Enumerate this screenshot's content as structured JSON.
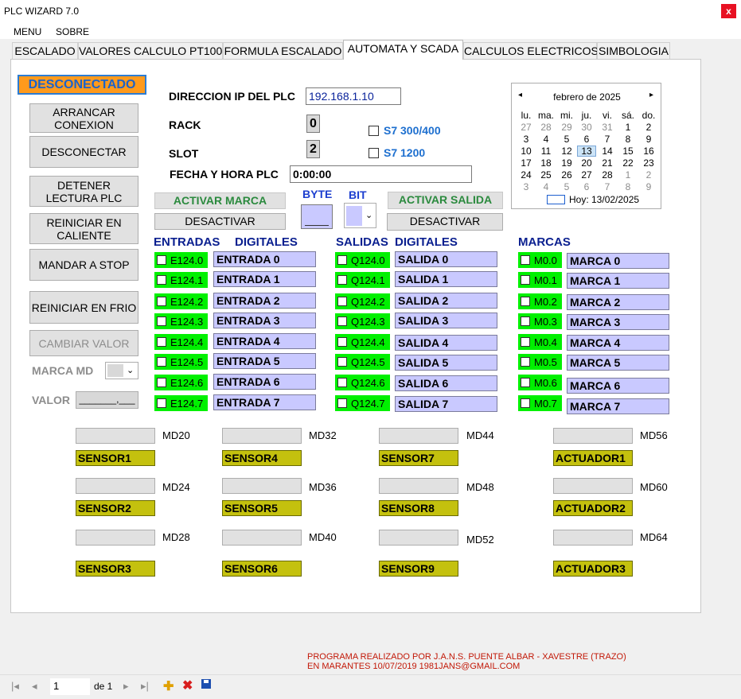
{
  "window": {
    "title": "PLC WIZARD 7.0",
    "close_glyph": "x"
  },
  "menu": [
    "MENU",
    "SOBRE"
  ],
  "tabs": [
    "ESCALADO",
    "VALORES CALCULO PT100",
    "FORMULA ESCALADO",
    "AUTOMATA Y SCADA",
    "CALCULOS ELECTRICOS",
    "SIMBOLOGIA"
  ],
  "status": "DESCONECTADO",
  "left_buttons": [
    "ARRANCAR CONEXION",
    "DESCONECTAR",
    "DETENER LECTURA PLC",
    "REINICIAR EN CALIENTE",
    "MANDAR A STOP",
    "REINICIAR EN FRIO",
    "CAMBIAR VALOR"
  ],
  "marca_md_label": "MARCA MD",
  "valor_label": "VALOR",
  "valor_value": "_______,___",
  "conn": {
    "ip_label": "DIRECCION IP DEL PLC",
    "ip": "192.168.1.10",
    "rack_label": "RACK",
    "rack": "0",
    "slot_label": "SLOT",
    "slot": "2",
    "fecha_label": "FECHA Y HORA PLC",
    "fecha": "0:00:00",
    "s7_300": "S7 300/400",
    "s7_1200": "S7 1200"
  },
  "activar_marca": "ACTIVAR MARCA",
  "desactivar": "DESACTIVAR",
  "byte_label": "BYTE",
  "bit_label": "BIT",
  "activar_salida": "ACTIVAR  SALIDA",
  "headers": {
    "entradas": "ENTRADAS",
    "digitales_in": "DIGITALES",
    "salidas": "SALIDAS",
    "digitales_out": "DIGITALES",
    "marcas": "MARCAS"
  },
  "entradas": [
    {
      "addr": "E124.0",
      "name": "ENTRADA 0"
    },
    {
      "addr": "E124.1",
      "name": "ENTRADA 1"
    },
    {
      "addr": "E124.2",
      "name": "ENTRADA 2"
    },
    {
      "addr": "E124.3",
      "name": "ENTRADA 3"
    },
    {
      "addr": "E124.4",
      "name": "ENTRADA 4"
    },
    {
      "addr": "E124.5",
      "name": "ENTRADA 5"
    },
    {
      "addr": "E124.6",
      "name": "ENTRADA 6"
    },
    {
      "addr": "E124.7",
      "name": "ENTRADA 7"
    }
  ],
  "salidas": [
    {
      "addr": "Q124.0",
      "name": "SALIDA 0"
    },
    {
      "addr": "Q124.1",
      "name": "SALIDA 1"
    },
    {
      "addr": "Q124.2",
      "name": "SALIDA 2"
    },
    {
      "addr": "Q124.3",
      "name": "SALIDA 3"
    },
    {
      "addr": "Q124.4",
      "name": "SALIDA 4"
    },
    {
      "addr": "Q124.5",
      "name": "SALIDA 5"
    },
    {
      "addr": "Q124.6",
      "name": "SALIDA 6"
    },
    {
      "addr": "Q124.7",
      "name": "SALIDA 7"
    }
  ],
  "marcas": [
    {
      "addr": "M0.0",
      "name": "MARCA 0"
    },
    {
      "addr": "M0.1",
      "name": "MARCA 1"
    },
    {
      "addr": "M0.2",
      "name": "MARCA 2"
    },
    {
      "addr": "M0.3",
      "name": "MARCA 3"
    },
    {
      "addr": "M0.4",
      "name": "MARCA 4"
    },
    {
      "addr": "M0.5",
      "name": "MARCA 5"
    },
    {
      "addr": "M0.6",
      "name": "MARCA 6"
    },
    {
      "addr": "M0.7",
      "name": "MARCA 7"
    }
  ],
  "sensors": [
    {
      "md": "MD20",
      "name": "SENSOR1"
    },
    {
      "md": "MD24",
      "name": "SENSOR2"
    },
    {
      "md": "MD28",
      "name": "SENSOR3"
    },
    {
      "md": "MD32",
      "name": "SENSOR4"
    },
    {
      "md": "MD36",
      "name": "SENSOR5"
    },
    {
      "md": "MD40",
      "name": "SENSOR6"
    },
    {
      "md": "MD44",
      "name": "SENSOR7"
    },
    {
      "md": "MD48",
      "name": "SENSOR8"
    },
    {
      "md": "MD52",
      "name": "SENSOR9"
    },
    {
      "md": "MD56",
      "name": "ACTUADOR1"
    },
    {
      "md": "MD60",
      "name": "ACTUADOR2"
    },
    {
      "md": "MD64",
      "name": "ACTUADOR3"
    }
  ],
  "calendar": {
    "month": "febrero de 2025",
    "days_header": [
      "lu.",
      "ma.",
      "mi.",
      "ju.",
      "vi.",
      "sá.",
      "do."
    ],
    "weeks": [
      [
        "27",
        "28",
        "29",
        "30",
        "31",
        "1",
        "2"
      ],
      [
        "3",
        "4",
        "5",
        "6",
        "7",
        "8",
        "9"
      ],
      [
        "10",
        "11",
        "12",
        "13",
        "14",
        "15",
        "16"
      ],
      [
        "17",
        "18",
        "19",
        "20",
        "21",
        "22",
        "23"
      ],
      [
        "24",
        "25",
        "26",
        "27",
        "28",
        "1",
        "2"
      ],
      [
        "3",
        "4",
        "5",
        "6",
        "7",
        "8",
        "9"
      ]
    ],
    "today": "Hoy: 13/02/2025",
    "prev_glyph": "◂",
    "next_glyph": "▸"
  },
  "footer": [
    "PROGRAMA REALIZADO POR J.A.N.S.  PUENTE ALBAR - XAVESTRE  (TRAZO)",
    "EN MARANTES 10/07/2019   1981JANS@GMAIL.COM"
  ],
  "nav": {
    "position": "1",
    "of": "de 1"
  }
}
